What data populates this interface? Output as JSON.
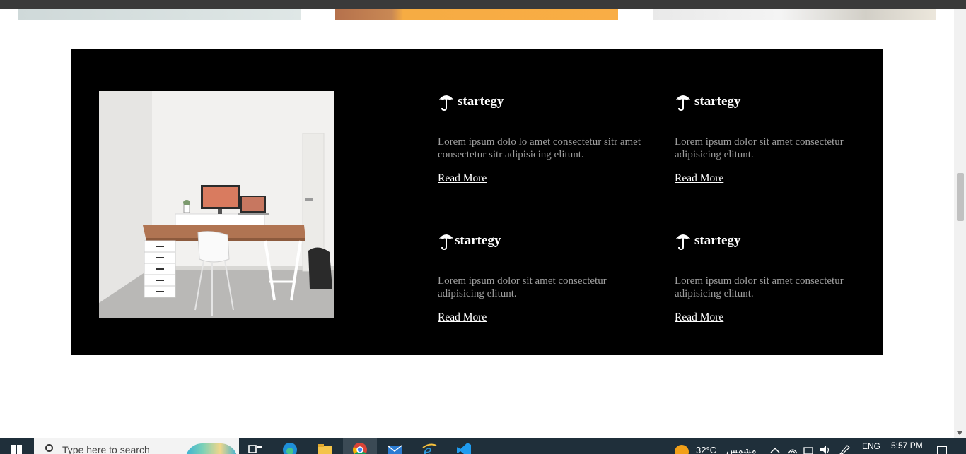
{
  "features": [
    {
      "icon": "umbrella-icon",
      "title": "startegy",
      "text": "Lorem ipsum dolo lo amet consectetur sitr amet consectetur sitr adipisicing elitunt.",
      "link": "Read More"
    },
    {
      "icon": "umbrella-icon",
      "title": "startegy",
      "text": "Lorem ipsum dolor sit amet consectetur adipisicing elitunt.",
      "link": "Read More"
    },
    {
      "icon": "umbrella-icon",
      "title": "startegy",
      "text": "Lorem ipsum dolor sit amet consectetur adipisicing elitunt.",
      "link": "Read More"
    },
    {
      "icon": "umbrella-icon",
      "title": "startegy",
      "text": "Lorem ipsum dolor sit amet consectetur adipisicing elitunt.",
      "link": "Read More"
    }
  ],
  "photo": {
    "subject": "desk-workspace-image"
  },
  "taskbar": {
    "search_placeholder": "Type here to search",
    "apps": [
      "task-view-icon",
      "edge-icon",
      "file-explorer-icon",
      "chrome-icon",
      "mail-icon",
      "internet-explorer-icon",
      "vscode-icon"
    ],
    "weather_temp": "32°C",
    "weather_text": "مشمس",
    "language": "ENG",
    "time": "5:57 PM"
  },
  "colors": {
    "section_bg": "#000000",
    "title": "#ffffff",
    "body_text": "#9e9e9e",
    "link": "#ffffff",
    "accent_card": "#f9ad45"
  }
}
